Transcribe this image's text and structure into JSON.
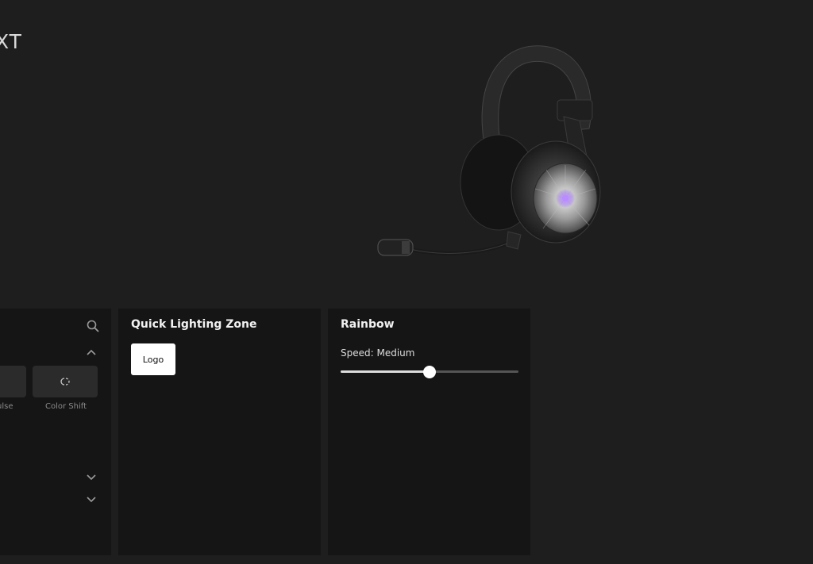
{
  "device": {
    "name_visible": "XT"
  },
  "effects_panel": {
    "effects": [
      {
        "label": "ulse",
        "icon": "pulse-icon"
      },
      {
        "label": "Color Shift",
        "icon": "color-shift-icon"
      }
    ]
  },
  "zone_panel": {
    "title": "Quick Lighting Zone",
    "zone_button": "Logo"
  },
  "rainbow_panel": {
    "title": "Rainbow",
    "speed_label": "Speed: Medium",
    "speed_value": 0.5
  },
  "colors": {
    "background": "#1e1e1e",
    "panel": "#151515",
    "headset_accent": "#8a3cff"
  }
}
